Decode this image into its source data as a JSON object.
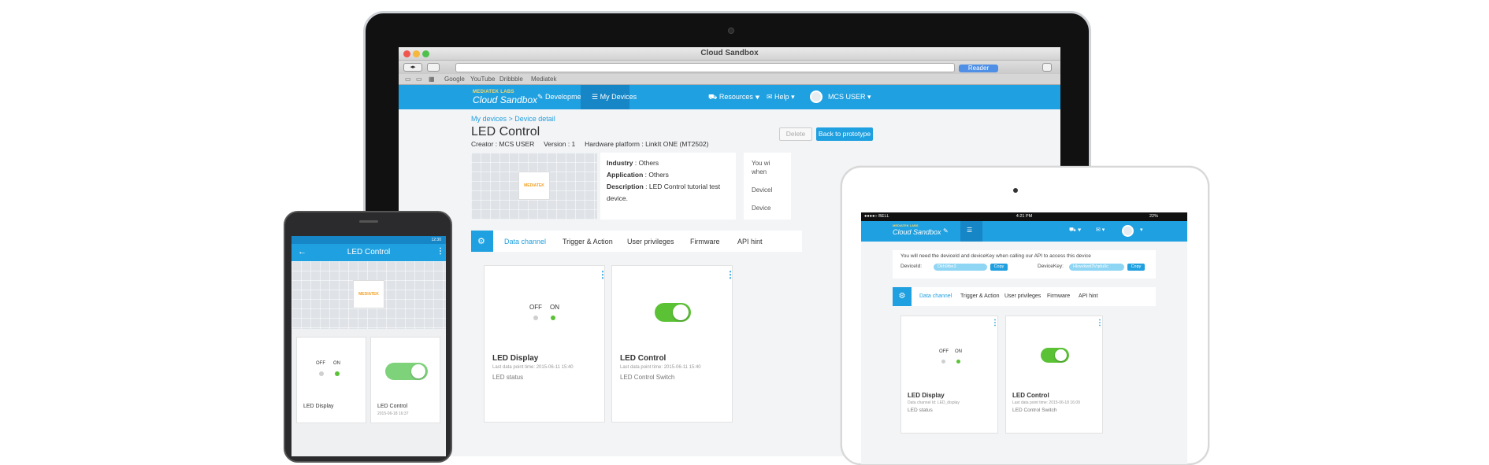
{
  "browser": {
    "window_title": "Cloud Sandbox",
    "reader_label": "Reader",
    "bookmarks": [
      "Google",
      "YouTube",
      "Dribbble",
      "Mediatek"
    ]
  },
  "app": {
    "logo_top": "MEDIATEK LABS",
    "logo_main": "Cloud Sandbox",
    "nav": {
      "development": "Development",
      "my_devices": "My Devices",
      "resources": "Resources",
      "help": "Help",
      "user": "MCS USER"
    }
  },
  "device": {
    "breadcrumb": "My devices > Device detail",
    "title": "LED Control",
    "creator": "Creator : MCS USER",
    "version": "Version : 1",
    "hardware": "Hardware platform : LinkIt ONE (MT2502)",
    "delete_label": "Delete",
    "back_label": "Back to prototype",
    "industry_key": "Industry",
    "industry_val": " : Others",
    "application_key": "Application",
    "application_val": " : Others",
    "description_key": "Description",
    "description_val": " : LED Control tutorial test device.",
    "keybox_lines": [
      "You wi",
      "when",
      "DeviceI",
      "Device"
    ],
    "chip_label": "MEDIATEK"
  },
  "tabs": [
    "Data channel",
    "Trigger & Action",
    "User privileges",
    "Firmware",
    "API hint"
  ],
  "cards": {
    "display": {
      "off": "OFF",
      "on": "ON",
      "title": "LED Display",
      "time": "Last data point time: 2015-06-11 15:40",
      "status": "LED status"
    },
    "control": {
      "title": "LED Control",
      "time": "Last data point time: 2015-06-11 15:40",
      "status": "LED Control Switch"
    },
    "kebab": "⋮"
  },
  "phone": {
    "status_time": "12:30",
    "title": "LED Control",
    "back_icon": "←",
    "display_title": "LED Display",
    "control_title": "LED Control",
    "control_time": "2015-06-18 16:37",
    "off": "OFF",
    "on": "ON"
  },
  "tablet": {
    "carrier": "●●●●○ BELL",
    "time": "4:21 PM",
    "battery": "22%",
    "notice": "You will need the deviceId and deviceKey when calling our API to access this device",
    "deviceid_label": "DeviceId:",
    "devicekey_label": "DeviceKey:",
    "deviceid_val": "Dkh9tbe3",
    "devicekey_val": "Hkwvkwd3Vqdu0c",
    "copy": "Copy",
    "display_sub": "Data channel Id: LED_display",
    "display_title": "LED Display",
    "display_status": "LED status",
    "control_sub": "Last data point time: 2015-06-18 16:09",
    "control_title": "LED Control",
    "control_status": "LED Control Switch"
  },
  "colors": {
    "accent": "#1fa0e0",
    "accent_dark": "#1686c7",
    "led_on": "#5bc236",
    "led_off": "#cfcfcf",
    "toggle_on": "#5bc236"
  }
}
